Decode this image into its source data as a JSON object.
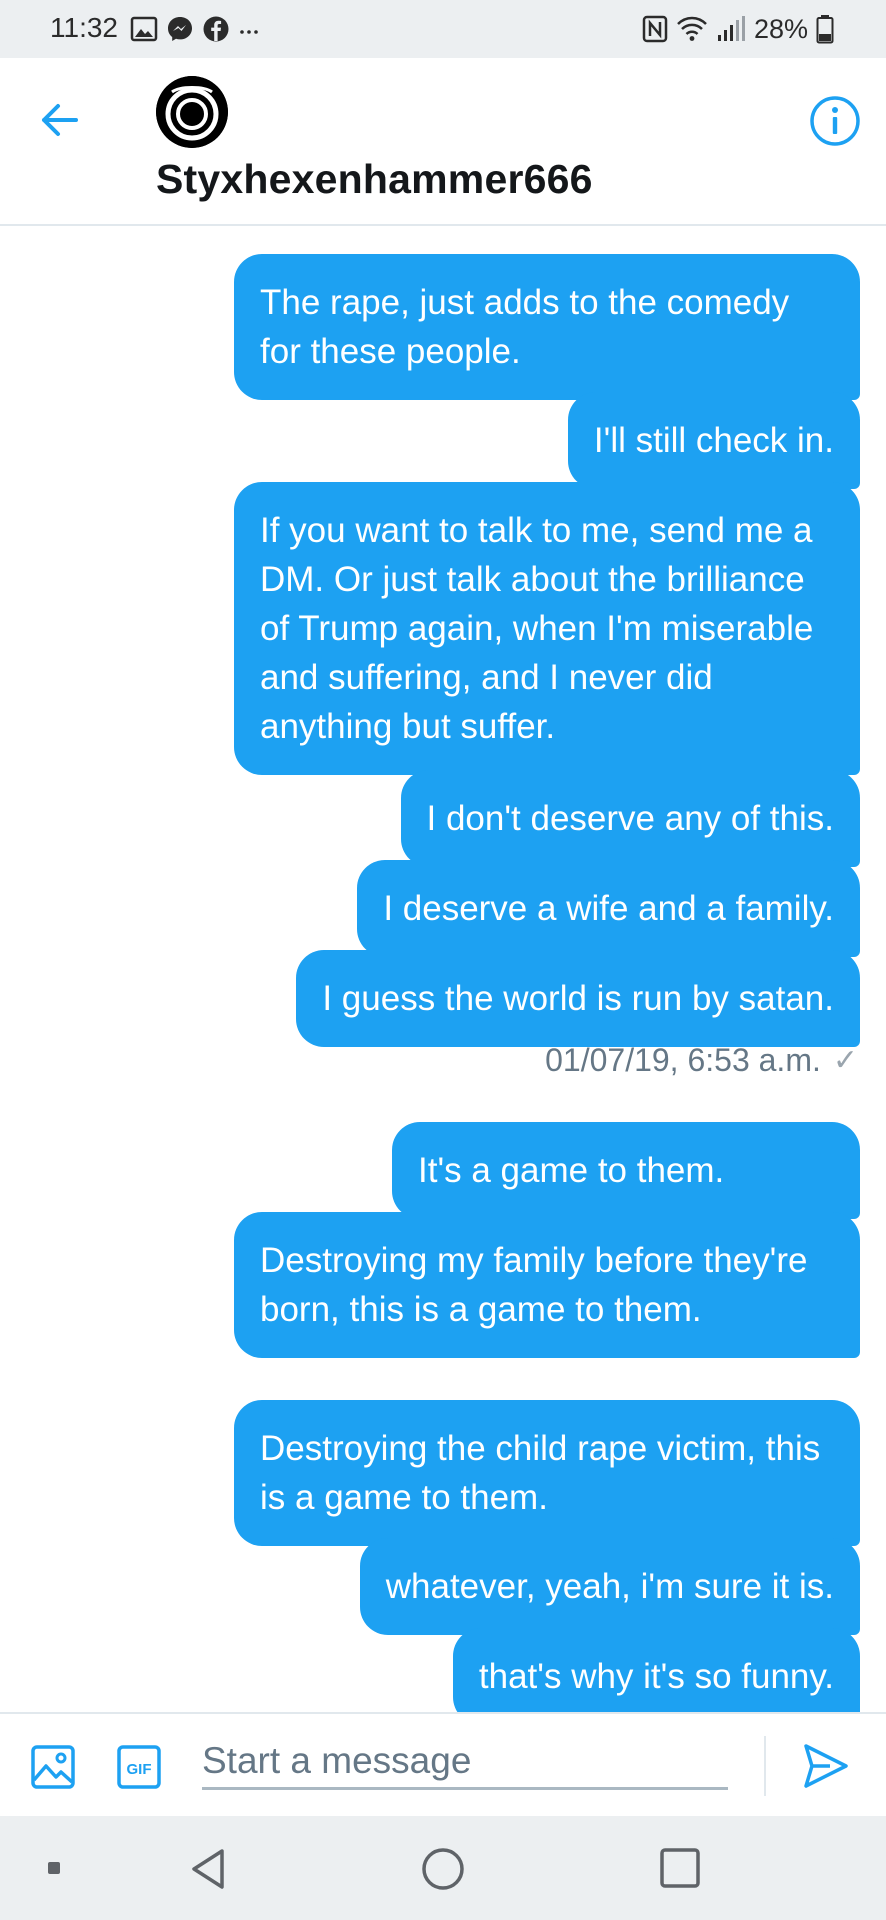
{
  "status_bar": {
    "time": "11:32",
    "battery": "28%",
    "left_icons": [
      "image-icon",
      "messenger-icon",
      "facebook-icon",
      "more-icon"
    ],
    "right_icons": [
      "nfc-icon",
      "wifi-icon",
      "signal-icon",
      "battery-icon"
    ]
  },
  "header": {
    "title": "Styxhexenhammer666",
    "back_icon": "arrow-left-icon",
    "info_icon": "info-icon",
    "accent_color": "#1da1f2"
  },
  "messages": [
    {
      "text": "The rape, just adds to the comedy for these people."
    },
    {
      "text": "I'll still check in."
    },
    {
      "text": "If you want to talk to me, send me a DM. Or just talk about the brilliance of Trump again, when I'm miserable and suffering, and I never did anything but suffer."
    },
    {
      "text": "I don't deserve any of this."
    },
    {
      "text": "I deserve a wife and a family."
    },
    {
      "text": "I guess the world is run by satan."
    },
    {
      "text": "It's a game to them."
    },
    {
      "text": "Destroying my family before they're born, this is a game to them."
    },
    {
      "text": "Destroying the child rape victim, this is a game to them."
    },
    {
      "text": "whatever, yeah, i'm sure it is."
    },
    {
      "text": "that's why it's so funny."
    }
  ],
  "timestamp": {
    "text": "01/07/19, 6:53 a.m.",
    "status": "✓"
  },
  "composer": {
    "placeholder": "Start a message",
    "value": "",
    "gif_label": "GIF"
  },
  "colors": {
    "bubble": "#1da1f2",
    "bubble_text": "#ffffff",
    "secondary_text": "#657786"
  }
}
